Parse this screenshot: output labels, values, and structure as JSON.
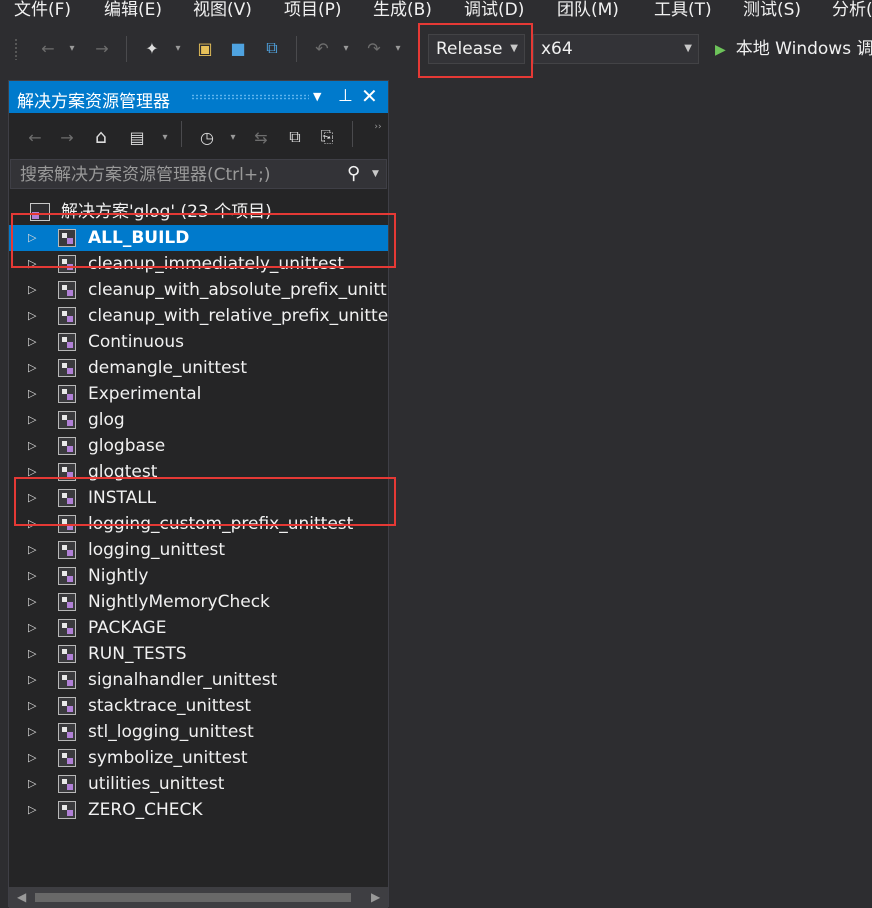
{
  "menu": [
    "文件(F)",
    "编辑(E)",
    "视图(V)",
    "项目(P)",
    "生成(B)",
    "调试(D)",
    "团队(M)",
    "工具(T)",
    "测试(S)",
    "分析("
  ],
  "toolbar": {
    "config": "Release",
    "platform": "x64",
    "run_label": "本地 Windows 调"
  },
  "explorer": {
    "title": "解决方案资源管理器",
    "search_placeholder": "搜索解决方案资源管理器(Ctrl+;)",
    "solution_label": "解决方案'glog' (23 个项目)",
    "projects": [
      "ALL_BUILD",
      "cleanup_immediately_unittest",
      "cleanup_with_absolute_prefix_unitt",
      "cleanup_with_relative_prefix_unitte",
      "Continuous",
      "demangle_unittest",
      "Experimental",
      "glog",
      "glogbase",
      "glogtest",
      "INSTALL",
      "logging_custom_prefix_unittest",
      "logging_unittest",
      "Nightly",
      "NightlyMemoryCheck",
      "PACKAGE",
      "RUN_TESTS",
      "signalhandler_unittest",
      "stacktrace_unittest",
      "stl_logging_unittest",
      "symbolize_unittest",
      "utilities_unittest",
      "ZERO_CHECK"
    ],
    "selected_project": "ALL_BUILD"
  },
  "colors": {
    "accent": "#007acc",
    "highlight_box": "#e53935"
  }
}
